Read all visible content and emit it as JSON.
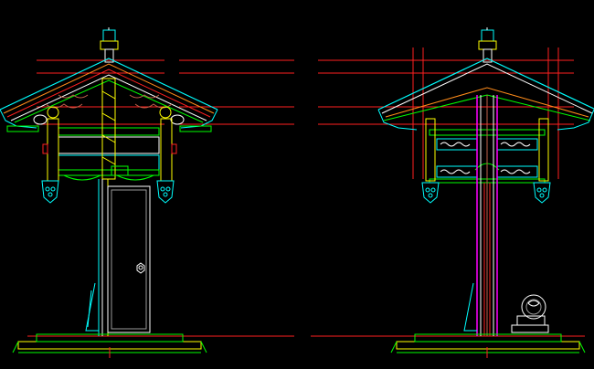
{
  "drawing": {
    "background": "#000000",
    "colors": {
      "red": "#ff2020",
      "yellow": "#ffff00",
      "green": "#00ff00",
      "cyan": "#00ffff",
      "magenta": "#ff00ff",
      "white": "#ffffff",
      "orange": "#ff8c1a",
      "brown": "#c0604a",
      "grey": "#9a9a9a",
      "blue": "#3a6bff"
    },
    "views": [
      {
        "name": "front-elevation"
      },
      {
        "name": "side-elevation"
      }
    ]
  }
}
